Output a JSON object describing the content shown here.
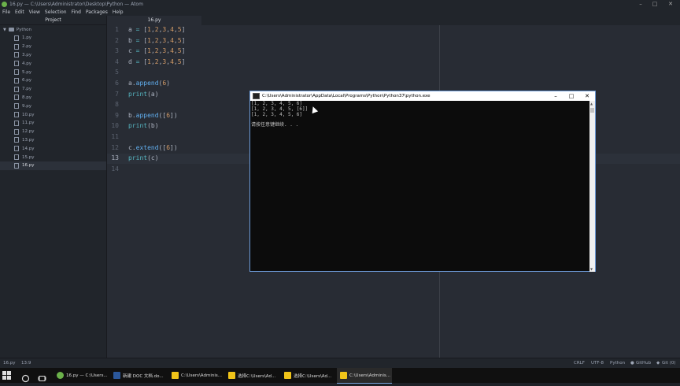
{
  "window": {
    "title": "16.py — C:\\Users\\Administrator\\Desktop\\Python — Atom"
  },
  "menu": [
    "File",
    "Edit",
    "View",
    "Selection",
    "Find",
    "Packages",
    "Help"
  ],
  "sidebar": {
    "header": "Project",
    "root": "Python",
    "files": [
      "1.py",
      "2.py",
      "3.py",
      "4.py",
      "5.py",
      "6.py",
      "7.py",
      "8.py",
      "9.py",
      "10.py",
      "11.py",
      "12.py",
      "13.py",
      "14.py",
      "15.py",
      "16.py"
    ],
    "active_file": "16.py"
  },
  "tab": {
    "label": "16.py"
  },
  "editor": {
    "current_line": 13,
    "lines": [
      {
        "n": "1",
        "tokens": [
          {
            "t": "a ",
            "c": "#abb2bf"
          },
          {
            "t": "=",
            "c": "#56b6c2"
          },
          {
            "t": " [",
            "c": "#abb2bf"
          },
          {
            "t": "1",
            "c": "#d19a66"
          },
          {
            "t": ",",
            "c": "#abb2bf"
          },
          {
            "t": "2",
            "c": "#d19a66"
          },
          {
            "t": ",",
            "c": "#abb2bf"
          },
          {
            "t": "3",
            "c": "#d19a66"
          },
          {
            "t": ",",
            "c": "#abb2bf"
          },
          {
            "t": "4",
            "c": "#d19a66"
          },
          {
            "t": ",",
            "c": "#abb2bf"
          },
          {
            "t": "5",
            "c": "#d19a66"
          },
          {
            "t": "]",
            "c": "#abb2bf"
          }
        ]
      },
      {
        "n": "2",
        "tokens": [
          {
            "t": "b ",
            "c": "#abb2bf"
          },
          {
            "t": "=",
            "c": "#56b6c2"
          },
          {
            "t": " [",
            "c": "#abb2bf"
          },
          {
            "t": "1",
            "c": "#d19a66"
          },
          {
            "t": ",",
            "c": "#abb2bf"
          },
          {
            "t": "2",
            "c": "#d19a66"
          },
          {
            "t": ",",
            "c": "#abb2bf"
          },
          {
            "t": "3",
            "c": "#d19a66"
          },
          {
            "t": ",",
            "c": "#abb2bf"
          },
          {
            "t": "4",
            "c": "#d19a66"
          },
          {
            "t": ",",
            "c": "#abb2bf"
          },
          {
            "t": "5",
            "c": "#d19a66"
          },
          {
            "t": "]",
            "c": "#abb2bf"
          }
        ]
      },
      {
        "n": "3",
        "tokens": [
          {
            "t": "c ",
            "c": "#abb2bf"
          },
          {
            "t": "=",
            "c": "#56b6c2"
          },
          {
            "t": " [",
            "c": "#abb2bf"
          },
          {
            "t": "1",
            "c": "#d19a66"
          },
          {
            "t": ",",
            "c": "#abb2bf"
          },
          {
            "t": "2",
            "c": "#d19a66"
          },
          {
            "t": ",",
            "c": "#abb2bf"
          },
          {
            "t": "3",
            "c": "#d19a66"
          },
          {
            "t": ",",
            "c": "#abb2bf"
          },
          {
            "t": "4",
            "c": "#d19a66"
          },
          {
            "t": ",",
            "c": "#abb2bf"
          },
          {
            "t": "5",
            "c": "#d19a66"
          },
          {
            "t": "]",
            "c": "#abb2bf"
          }
        ]
      },
      {
        "n": "4",
        "tokens": [
          {
            "t": "d ",
            "c": "#abb2bf"
          },
          {
            "t": "=",
            "c": "#56b6c2"
          },
          {
            "t": " [",
            "c": "#abb2bf"
          },
          {
            "t": "1",
            "c": "#d19a66"
          },
          {
            "t": ",",
            "c": "#abb2bf"
          },
          {
            "t": "2",
            "c": "#d19a66"
          },
          {
            "t": ",",
            "c": "#abb2bf"
          },
          {
            "t": "3",
            "c": "#d19a66"
          },
          {
            "t": ",",
            "c": "#abb2bf"
          },
          {
            "t": "4",
            "c": "#d19a66"
          },
          {
            "t": ",",
            "c": "#abb2bf"
          },
          {
            "t": "5",
            "c": "#d19a66"
          },
          {
            "t": "]",
            "c": "#abb2bf"
          }
        ]
      },
      {
        "n": "5",
        "tokens": []
      },
      {
        "n": "6",
        "tokens": [
          {
            "t": "a.",
            "c": "#abb2bf"
          },
          {
            "t": "append",
            "c": "#61afef"
          },
          {
            "t": "(",
            "c": "#abb2bf"
          },
          {
            "t": "6",
            "c": "#d19a66"
          },
          {
            "t": ")",
            "c": "#abb2bf"
          }
        ]
      },
      {
        "n": "7",
        "tokens": [
          {
            "t": "print",
            "c": "#56b6c2"
          },
          {
            "t": "(a)",
            "c": "#abb2bf"
          }
        ]
      },
      {
        "n": "8",
        "tokens": []
      },
      {
        "n": "9",
        "tokens": [
          {
            "t": "b.",
            "c": "#abb2bf"
          },
          {
            "t": "append",
            "c": "#61afef"
          },
          {
            "t": "([",
            "c": "#abb2bf"
          },
          {
            "t": "6",
            "c": "#d19a66"
          },
          {
            "t": "])",
            "c": "#abb2bf"
          }
        ]
      },
      {
        "n": "10",
        "tokens": [
          {
            "t": "print",
            "c": "#56b6c2"
          },
          {
            "t": "(b)",
            "c": "#abb2bf"
          }
        ]
      },
      {
        "n": "11",
        "tokens": []
      },
      {
        "n": "12",
        "tokens": [
          {
            "t": "c.",
            "c": "#abb2bf"
          },
          {
            "t": "extend",
            "c": "#61afef"
          },
          {
            "t": "([",
            "c": "#abb2bf"
          },
          {
            "t": "6",
            "c": "#d19a66"
          },
          {
            "t": "])",
            "c": "#abb2bf"
          }
        ]
      },
      {
        "n": "13",
        "tokens": [
          {
            "t": "print",
            "c": "#56b6c2"
          },
          {
            "t": "(c)",
            "c": "#abb2bf"
          }
        ]
      },
      {
        "n": "14",
        "tokens": []
      }
    ]
  },
  "console": {
    "title": "C:\\Users\\Administrator\\AppData\\Local\\Programs\\Python\\Python37\\python.exe",
    "lines": [
      "[1, 2, 3, 4, 5, 6]",
      "[1, 2, 3, 4, 5, [6]]",
      "[1, 2, 3, 4, 5, 6]",
      "",
      "请按任意键继续. . ."
    ]
  },
  "statusbar": {
    "file": "16.py",
    "cursor": "13:9",
    "line_ending": "CRLF",
    "encoding": "UTF-8",
    "grammar": "Python",
    "github": "GitHub",
    "git": "Git (0)"
  },
  "taskbar": {
    "buttons": [
      {
        "label": "16.py — C:\\Users...",
        "icon": "atom-icon",
        "color": "#6bb14a"
      },
      {
        "label": "新建 DOC 文档.do...",
        "icon": "word-icon",
        "color": "#2b579a"
      },
      {
        "label": "C:\\Users\\Adminis...",
        "icon": "python-icon",
        "color": "#f0c419"
      },
      {
        "label": "选择C:\\Users\\Ad...",
        "icon": "python-icon",
        "color": "#f0c419"
      },
      {
        "label": "选择C:\\Users\\Ad...",
        "icon": "python-icon",
        "color": "#f0c419"
      },
      {
        "label": "C:\\Users\\Adminis...",
        "icon": "python-icon",
        "color": "#f0c419"
      }
    ],
    "active_index": 5
  }
}
